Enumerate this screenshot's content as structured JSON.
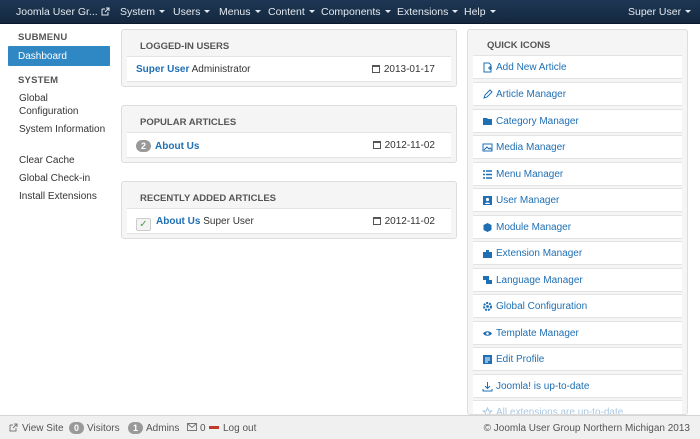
{
  "navbar": {
    "brand": "Joomla User Gr...",
    "menus": [
      "System",
      "Users",
      "Menus",
      "Content",
      "Components",
      "Extensions",
      "Help"
    ],
    "user": "Super User"
  },
  "sidebar": {
    "submenu_heading": "SUBMENU",
    "active_item": "Dashboard",
    "system_heading": "SYSTEM",
    "items": [
      "Global Configuration",
      "System Information",
      "Clear Cache",
      "Global Check-in",
      "Install Extensions"
    ]
  },
  "logged_in": {
    "title": "LOGGED-IN USERS",
    "user": "Super User",
    "role": "Administrator",
    "date": "2013-01-17"
  },
  "popular": {
    "title": "POPULAR ARTICLES",
    "hits": "2",
    "article": "About Us",
    "date": "2012-11-02"
  },
  "recent": {
    "title": "RECENTLY ADDED ARTICLES",
    "article": "About Us",
    "author": "Super User",
    "date": "2012-11-02"
  },
  "quick_icons": {
    "title": "QUICK ICONS",
    "items": [
      {
        "label": "Add New Article",
        "icon": "new-article-icon"
      },
      {
        "label": "Article Manager",
        "icon": "pencil-icon"
      },
      {
        "label": "Category Manager",
        "icon": "folder-icon"
      },
      {
        "label": "Media Manager",
        "icon": "image-icon"
      },
      {
        "label": "Menu Manager",
        "icon": "list-icon"
      },
      {
        "label": "User Manager",
        "icon": "user-icon"
      },
      {
        "label": "Module Manager",
        "icon": "cube-icon"
      },
      {
        "label": "Extension Manager",
        "icon": "puzzle-icon"
      },
      {
        "label": "Language Manager",
        "icon": "comments-icon"
      },
      {
        "label": "Global Configuration",
        "icon": "cog-icon"
      },
      {
        "label": "Template Manager",
        "icon": "eye-icon"
      },
      {
        "label": "Edit Profile",
        "icon": "profile-icon"
      },
      {
        "label": "Joomla! is up-to-date",
        "icon": "download-icon"
      },
      {
        "label": "All extensions are up-to-date",
        "icon": "star-icon"
      }
    ]
  },
  "status_bar": {
    "view_site": "View Site",
    "visitors_count": "0",
    "visitors_label": "Visitors",
    "admins_count": "1",
    "admins_label": "Admins",
    "messages_count": "0",
    "logout": "Log out",
    "copyright": "© Joomla User Group Northern Michigan 2013"
  },
  "colors": {
    "navbar": "#1e3754",
    "accent": "#2f87c4",
    "link": "#1e6fb3"
  }
}
